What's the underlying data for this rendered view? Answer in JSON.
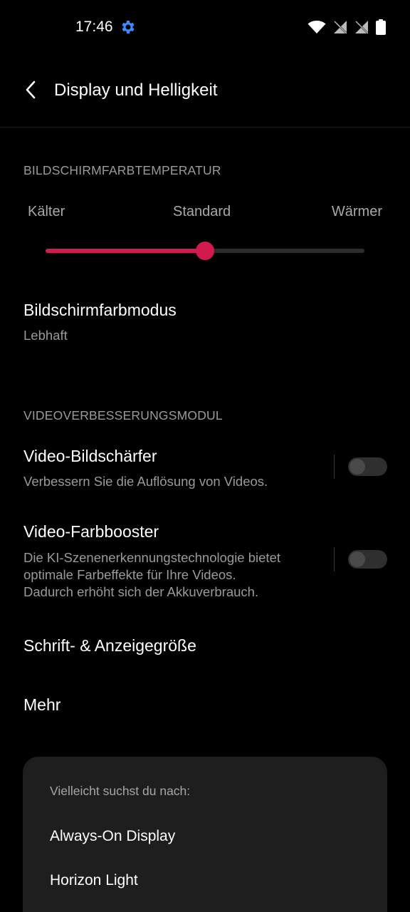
{
  "status_bar": {
    "time": "17:46",
    "icons": [
      "settings-gear-icon",
      "wifi-icon",
      "no-sim-icon",
      "no-sim-icon",
      "battery-icon"
    ],
    "accent_color": "#3d8bff"
  },
  "header": {
    "title": "Display und Helligkeit",
    "back_icon": "back-chevron-icon"
  },
  "color_temperature": {
    "section_label": "BILDSCHIRMFARBTEMPERATUR",
    "label_left": "Kälter",
    "label_center": "Standard",
    "label_right": "Wärmer",
    "value_fraction": 0.5,
    "accent_color": "#d21a4f"
  },
  "color_mode": {
    "title": "Bildschirmfarbmodus",
    "value": "Lebhaft"
  },
  "video_module": {
    "section_label": "VIDEOVERBESSERUNGSMODUL",
    "sharpener": {
      "title": "Video-Bildschärfer",
      "description": "Verbessern Sie die Auflösung von Videos.",
      "enabled": false
    },
    "color_booster": {
      "title": "Video-Farbbooster",
      "description_line1": "Die KI-Szenenerkennungstechnologie bietet",
      "description_line2": "optimale Farbeffekte für Ihre Videos.",
      "description_line3": "Dadurch erhöht sich der Akkuverbrauch.",
      "enabled": false
    }
  },
  "font_size": {
    "title": "Schrift- & Anzeigegröße"
  },
  "more": {
    "title": "Mehr"
  },
  "suggestions": {
    "header": "Vielleicht suchst du nach:",
    "items": [
      "Always-On Display",
      "Horizon Light"
    ]
  }
}
